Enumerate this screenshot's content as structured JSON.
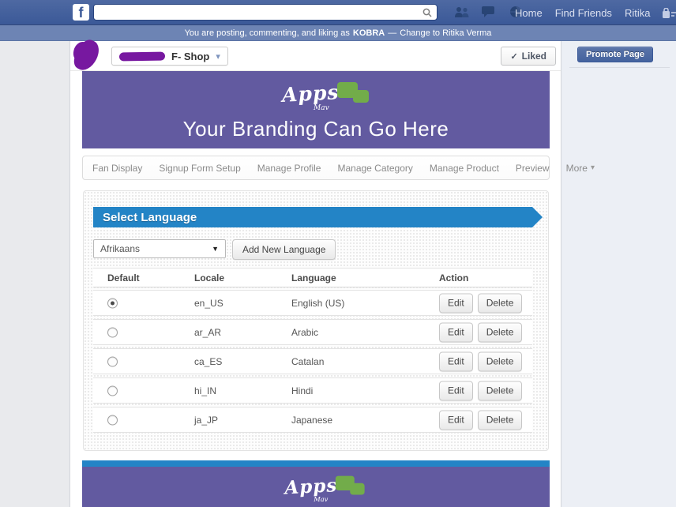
{
  "topbar": {
    "search": {
      "placeholder": "",
      "value": ""
    },
    "nav_links": [
      {
        "label": "Home"
      },
      {
        "label": "Find Friends"
      },
      {
        "label": "Ritika"
      }
    ],
    "icons": [
      "friend-requests",
      "messages",
      "notifications",
      "privacy-shortcuts",
      "settings"
    ]
  },
  "notice": {
    "prefix": "You are posting, commenting, and liking as",
    "identity": "KOBRA",
    "dash": "—",
    "change_link": "Change to Ritika Verma"
  },
  "page_header": {
    "app_crumb": "F- Shop",
    "liked_label": "Liked",
    "promote_label": "Promote Page"
  },
  "branding": {
    "logo_main": "Apps",
    "logo_sub": "Mav",
    "tagline": "Your Branding Can Go Here"
  },
  "tabs": [
    {
      "label": "Fan Display"
    },
    {
      "label": "Signup Form Setup"
    },
    {
      "label": "Manage Profile"
    },
    {
      "label": "Manage Category"
    },
    {
      "label": "Manage Product"
    },
    {
      "label": "Preview"
    },
    {
      "label": "More"
    }
  ],
  "section": {
    "title": "Select Language",
    "selected_language": "Afrikaans",
    "add_button_label": "Add New Language",
    "table": {
      "headers": {
        "default": "Default",
        "locale": "Locale",
        "language": "Language",
        "action": "Action"
      },
      "edit_label": "Edit",
      "delete_label": "Delete",
      "rows": [
        {
          "locale": "en_US",
          "language": "English (US)",
          "is_default": true
        },
        {
          "locale": "ar_AR",
          "language": "Arabic",
          "is_default": false
        },
        {
          "locale": "ca_ES",
          "language": "Catalan",
          "is_default": false
        },
        {
          "locale": "hi_IN",
          "language": "Hindi",
          "is_default": false
        },
        {
          "locale": "ja_JP",
          "language": "Japanese",
          "is_default": false
        }
      ]
    }
  },
  "footer": {
    "logo_main": "Apps",
    "logo_sub": "Mav"
  },
  "icons": {
    "caret_down": "▾",
    "select_caret": "▼",
    "check": "✓",
    "gear": "⚙"
  },
  "colors": {
    "fb_blue": "#3b5998",
    "notice_blue": "#6d84b4",
    "brand_purple": "#625aa0",
    "banner_blue": "#2384c6",
    "logo_green": "#72ac4a",
    "scribble_purple": "#7718a0"
  }
}
